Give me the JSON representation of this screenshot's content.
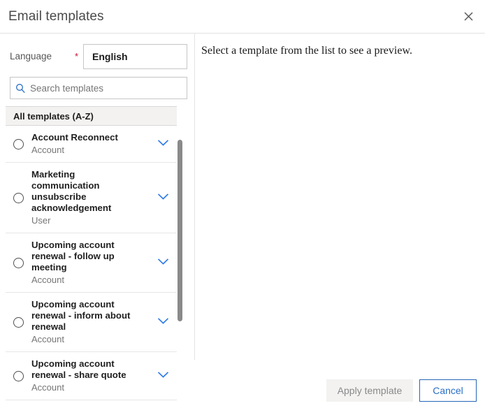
{
  "dialog": {
    "title": "Email templates",
    "close_icon": "close-icon"
  },
  "form": {
    "language_label": "Language",
    "required_marker": "*",
    "language_value": "English"
  },
  "search": {
    "icon": "search-icon",
    "placeholder": "Search templates",
    "value": ""
  },
  "list": {
    "group_header": "All templates (A-Z)",
    "expand_icon": "chevron-down-icon",
    "items": [
      {
        "title": "Account Reconnect",
        "subtitle": "Account",
        "selected": false
      },
      {
        "title": "Marketing communication unsubscribe acknowledgement",
        "subtitle": "User",
        "selected": false
      },
      {
        "title": "Upcoming account renewal - follow up meeting",
        "subtitle": "Account",
        "selected": false
      },
      {
        "title": "Upcoming account renewal - inform about renewal",
        "subtitle": "Account",
        "selected": false
      },
      {
        "title": "Upcoming account renewal - share quote",
        "subtitle": "Account",
        "selected": false
      }
    ]
  },
  "preview": {
    "empty_message": "Select a template from the list to see a preview."
  },
  "footer": {
    "apply_label": "Apply template",
    "cancel_label": "Cancel"
  },
  "colors": {
    "accent_blue": "#2a6fc4",
    "chevron_blue": "#2f7ae5",
    "required_red": "#c8102e",
    "group_header_bg": "#f3f2f1",
    "disabled_text": "#898989"
  }
}
